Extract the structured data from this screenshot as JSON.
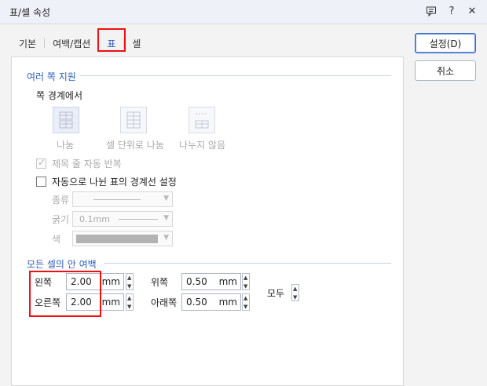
{
  "window": {
    "title": "표/셀 속성"
  },
  "tabs": [
    {
      "label": "기본"
    },
    {
      "label": "여백/캡션"
    },
    {
      "label": "표"
    },
    {
      "label": "셀"
    }
  ],
  "buttons": {
    "ok": "설정(D)",
    "cancel": "취소"
  },
  "multi_page": {
    "title": "여러 쪽 지원",
    "boundary_label": "쪽 경계에서",
    "options": [
      "나눔",
      "셀 단위로 나눔",
      "나누지 않음"
    ],
    "repeat_header": "제목 줄 자동 반복",
    "auto_border": "자동으로 나뉜 표의 경계선 설정",
    "type_label": "종류",
    "thickness_label": "굵기",
    "thickness_value": "0.1mm",
    "color_label": "색"
  },
  "cell_margin": {
    "title": "모든 셀의 안 여백",
    "left_label": "왼쪽",
    "left_value": "2.00",
    "right_label": "오른쪽",
    "right_value": "2.00",
    "top_label": "위쪽",
    "top_value": "0.50",
    "bottom_label": "아래쪽",
    "bottom_value": "0.50",
    "all_label": "모두",
    "unit": "mm"
  }
}
